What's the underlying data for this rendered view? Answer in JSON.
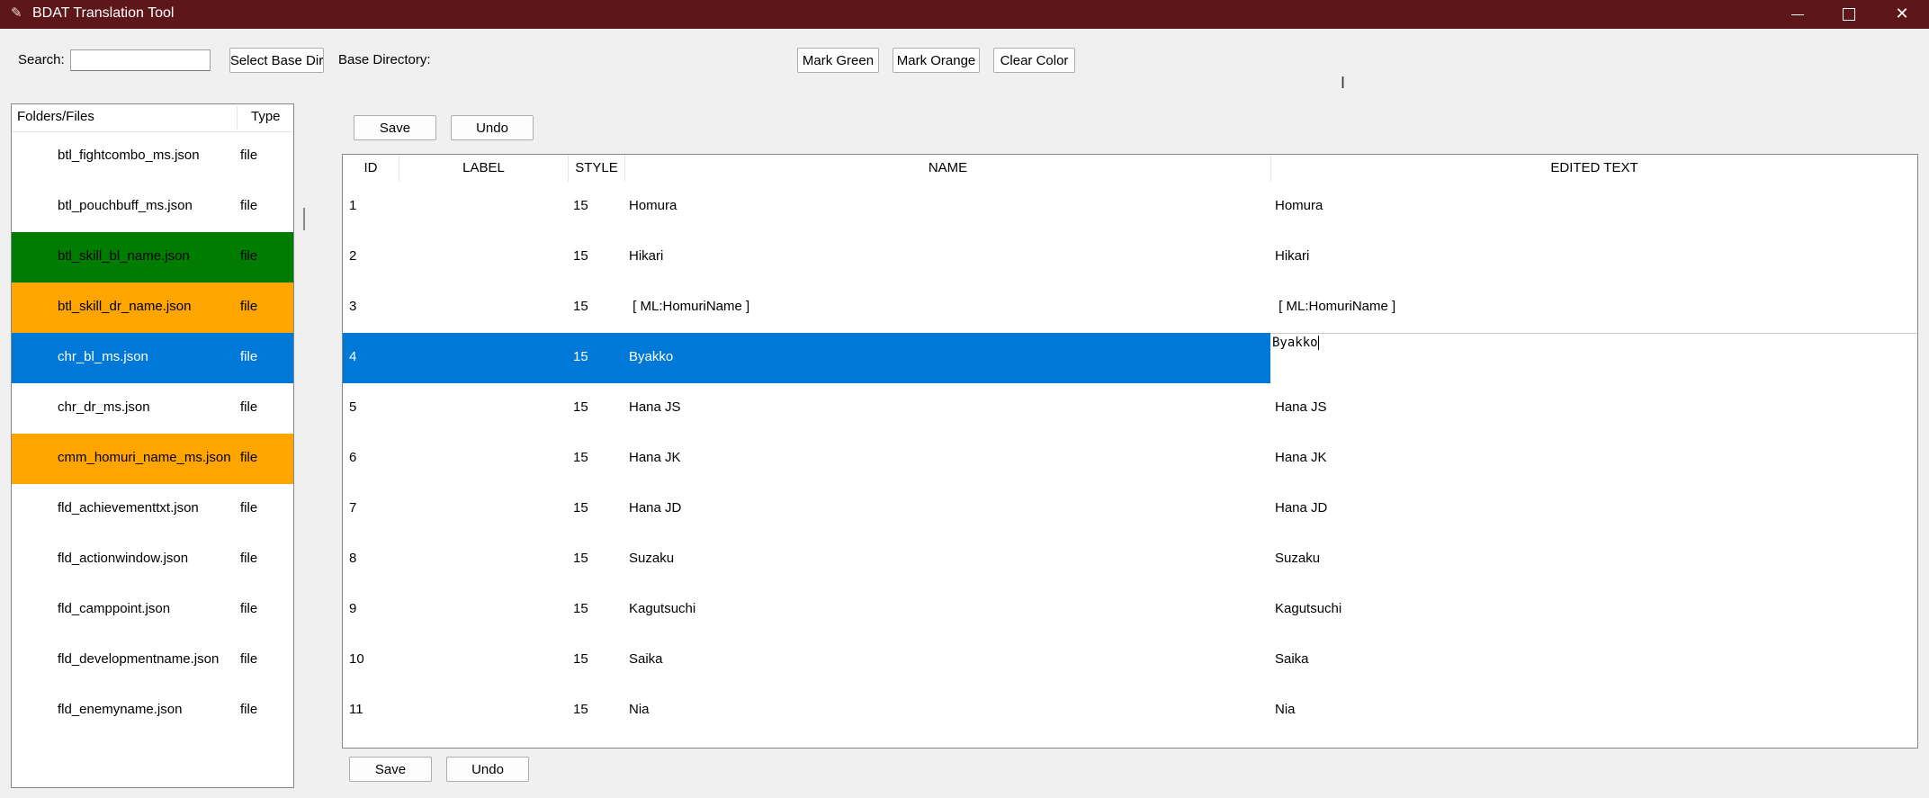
{
  "window": {
    "title": "BDAT Translation Tool",
    "controls": {
      "minimize": "—",
      "maximize": "☐",
      "close": "✕"
    },
    "title_bar_color": "#5e1719"
  },
  "toolbar": {
    "search_label": "Search:",
    "search_value": "",
    "select_base_dir": "Select Base Dir",
    "base_directory_label": "Base Directory:",
    "mark_green": "Mark Green",
    "mark_orange": "Mark Orange",
    "clear_color": "Clear Color"
  },
  "tree": {
    "col_name": "Folders/Files",
    "col_type": "Type",
    "items": [
      {
        "name": "btl_fightcombo_ms.json",
        "type": "file",
        "mark": "none"
      },
      {
        "name": "btl_pouchbuff_ms.json",
        "type": "file",
        "mark": "none"
      },
      {
        "name": "btl_skill_bl_name.json",
        "type": "file",
        "mark": "green"
      },
      {
        "name": "btl_skill_dr_name.json",
        "type": "file",
        "mark": "orange"
      },
      {
        "name": "chr_bl_ms.json",
        "type": "file",
        "mark": "selected"
      },
      {
        "name": "chr_dr_ms.json",
        "type": "file",
        "mark": "none"
      },
      {
        "name": "cmm_homuri_name_ms.json",
        "type": "file",
        "mark": "orange"
      },
      {
        "name": "fld_achievementtxt.json",
        "type": "file",
        "mark": "none"
      },
      {
        "name": "fld_actionwindow.json",
        "type": "file",
        "mark": "none"
      },
      {
        "name": "fld_camppoint.json",
        "type": "file",
        "mark": "none"
      },
      {
        "name": "fld_developmentname.json",
        "type": "file",
        "mark": "none"
      },
      {
        "name": "fld_enemyname.json",
        "type": "file",
        "mark": "none"
      }
    ]
  },
  "editor": {
    "save_label": "Save",
    "undo_label": "Undo",
    "columns": {
      "id": "ID",
      "label": "LABEL",
      "style": "STYLE",
      "name": "NAME",
      "edited": "EDITED TEXT"
    },
    "rows": [
      {
        "id": "1",
        "label": "",
        "style": "15",
        "name": "Homura",
        "edited": "Homura"
      },
      {
        "id": "2",
        "label": "",
        "style": "15",
        "name": "Hikari",
        "edited": "Hikari"
      },
      {
        "id": "3",
        "label": "",
        "style": "15",
        "name": " [ ML:HomuriName ] ",
        "edited": " [ ML:HomuriName ] "
      },
      {
        "id": "4",
        "label": "",
        "style": "15",
        "name": "Byakko",
        "edited": "Byakko",
        "selected": true,
        "editing": true
      },
      {
        "id": "5",
        "label": "",
        "style": "15",
        "name": "Hana JS",
        "edited": "Hana JS"
      },
      {
        "id": "6",
        "label": "",
        "style": "15",
        "name": "Hana JK",
        "edited": "Hana JK"
      },
      {
        "id": "7",
        "label": "",
        "style": "15",
        "name": "Hana JD",
        "edited": "Hana JD"
      },
      {
        "id": "8",
        "label": "",
        "style": "15",
        "name": "Suzaku",
        "edited": "Suzaku"
      },
      {
        "id": "9",
        "label": "",
        "style": "15",
        "name": "Kagutsuchi",
        "edited": "Kagutsuchi"
      },
      {
        "id": "10",
        "label": "",
        "style": "15",
        "name": "Saika",
        "edited": "Saika"
      },
      {
        "id": "11",
        "label": "",
        "style": "15",
        "name": "Nia",
        "edited": "Nia"
      }
    ]
  },
  "colors": {
    "green": "#007d00",
    "orange": "#ffa500",
    "selected": "#0078d7"
  }
}
